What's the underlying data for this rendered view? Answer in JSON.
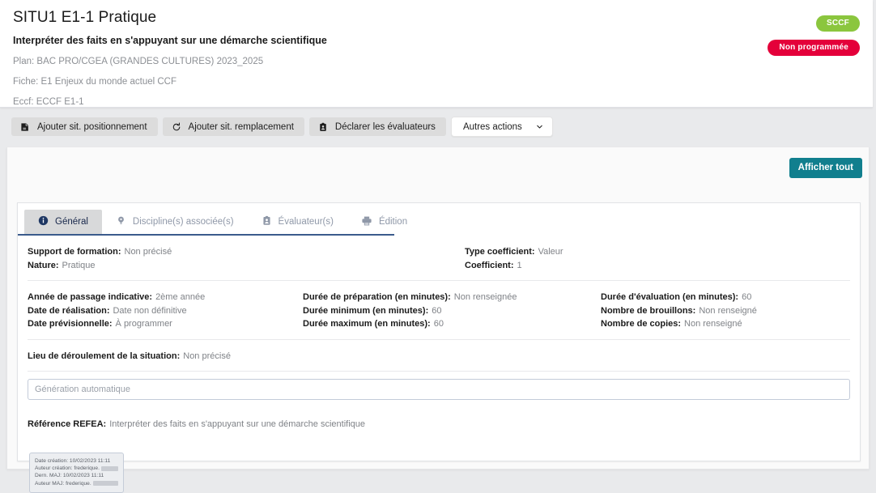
{
  "header": {
    "title": "SITU1 E1-1 Pratique",
    "subtitle": "Interpréter des faits en s'appuyant sur une démarche scientifique",
    "meta": [
      "Plan: BAC PRO/CGEA (GRANDES CULTURES) 2023_2025",
      "Fiche: E1 Enjeux du monde actuel CCF",
      "Eccf: ECCF E1-1"
    ],
    "badges": [
      {
        "label": "SCCF",
        "color": "#8bc63e"
      },
      {
        "label": "Non programmée",
        "color": "#e4003a"
      }
    ]
  },
  "toolbar": {
    "buttons": [
      {
        "label": "Ajouter sit. positionnement",
        "icon": "add-position-icon"
      },
      {
        "label": "Ajouter sit. remplacement",
        "icon": "refresh-icon"
      },
      {
        "label": "Déclarer les évaluateurs",
        "icon": "clipboard-person-icon"
      }
    ],
    "dropdown": {
      "label": "Autres actions",
      "icon": "chevron-down-icon"
    }
  },
  "panel": {
    "show_all_label": "Afficher tout"
  },
  "tabs": [
    {
      "label": "Général",
      "icon": "info-icon",
      "active": true
    },
    {
      "label": "Discipline(s) associée(s)",
      "icon": "lightbulb-icon",
      "active": false
    },
    {
      "label": "Évaluateur(s)",
      "icon": "clipboard-person-icon",
      "active": false
    },
    {
      "label": "Édition",
      "icon": "printer-icon",
      "active": false
    }
  ],
  "general": {
    "row1": {
      "col1": [
        {
          "label": "Support de formation:",
          "value": "Non précisé"
        },
        {
          "label": "Nature:",
          "value": "Pratique"
        }
      ],
      "col2": [
        {
          "label": "Type coefficient:",
          "value": "Valeur"
        },
        {
          "label": "Coefficient:",
          "value": "1"
        }
      ]
    },
    "row2": {
      "col1": [
        {
          "label": "Année de passage indicative:",
          "value": "2ème année"
        },
        {
          "label": "Date de réalisation:",
          "value": "Date non définitive"
        },
        {
          "label": "Date prévisionnelle:",
          "value": "À programmer"
        }
      ],
      "col2": [
        {
          "label": "Durée de préparation (en minutes):",
          "value": "Non renseignée"
        },
        {
          "label": "Durée minimum (en minutes):",
          "value": "60"
        },
        {
          "label": "Durée maximum (en minutes):",
          "value": "60"
        }
      ],
      "col3": [
        {
          "label": "Durée d'évaluation (en minutes):",
          "value": "60"
        },
        {
          "label": "Nombre de brouillons:",
          "value": "Non renseigné"
        },
        {
          "label": "Nombre de copies:",
          "value": "Non renseigné"
        }
      ]
    },
    "row3": {
      "label": "Lieu de déroulement de la situation:",
      "value": "Non précisé"
    },
    "input": {
      "placeholder": "Génération automatique",
      "value": ""
    },
    "row4": {
      "label": "Référence REFEA:",
      "value": "Interpréter des faits en s'appuyant sur une démarche scientifique"
    },
    "metadata": [
      {
        "label": "Date création:",
        "value": "10/02/2023 11:11",
        "redacted": false
      },
      {
        "label": "Auteur création:",
        "value": "frederique.",
        "redacted": true
      },
      {
        "label": "Dern. MAJ:",
        "value": "10/02/2023 11:11",
        "redacted": false
      },
      {
        "label": "Auteur MAJ:",
        "value": "frederique.",
        "redacted": true
      }
    ]
  }
}
